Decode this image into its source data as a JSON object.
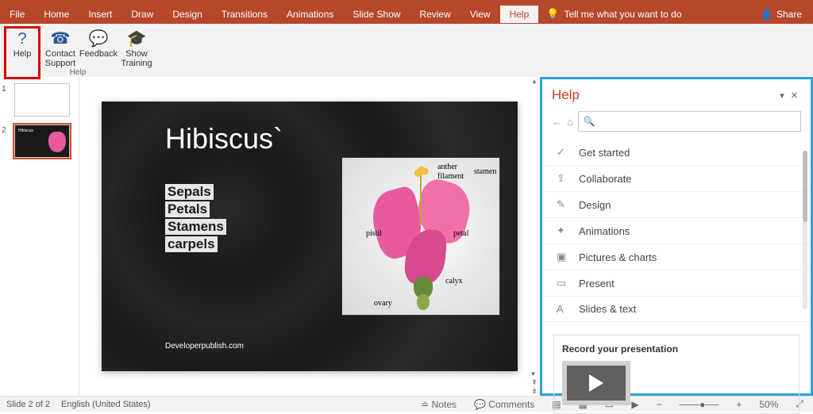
{
  "ribbon": {
    "tabs": [
      "File",
      "Home",
      "Insert",
      "Draw",
      "Design",
      "Transitions",
      "Animations",
      "Slide Show",
      "Review",
      "View",
      "Help"
    ],
    "active_tab": "Help",
    "tell_me": "Tell me what you want to do",
    "share": "Share"
  },
  "help_group": {
    "buttons": [
      {
        "label": "Help",
        "icon": "?"
      },
      {
        "label": "Contact Support",
        "icon": "☎"
      },
      {
        "label": "Feedback",
        "icon": "💬"
      },
      {
        "label": "Show Training",
        "icon": "🎓"
      }
    ],
    "group_label": "Help"
  },
  "thumbnails": [
    {
      "num": "1"
    },
    {
      "num": "2"
    }
  ],
  "slide": {
    "title": "Hibiscus`",
    "bullets": [
      "Sepals",
      "Petals",
      "Stamens",
      "carpels"
    ],
    "credit": "Developerpublish.com",
    "diagram_labels": {
      "anther": "anther",
      "filament": "filament",
      "stamen": "stamen",
      "pistil": "pistil",
      "petal": "petal",
      "calyx": "calyx",
      "ovary": "ovary"
    }
  },
  "help_pane": {
    "title": "Help",
    "search_value": "",
    "items": [
      {
        "icon": "✓",
        "label": "Get started"
      },
      {
        "icon": "⇪",
        "label": "Collaborate"
      },
      {
        "icon": "✎",
        "label": "Design"
      },
      {
        "icon": "✦",
        "label": "Animations"
      },
      {
        "icon": "▣",
        "label": "Pictures & charts"
      },
      {
        "icon": "▭",
        "label": "Present"
      },
      {
        "icon": "A",
        "label": "Slides & text"
      }
    ],
    "feature_title": "Record your presentation"
  },
  "status": {
    "slide_indicator": "Slide 2 of 2",
    "language": "English (United States)",
    "notes": "Notes",
    "comments": "Comments",
    "zoom": "50%"
  }
}
